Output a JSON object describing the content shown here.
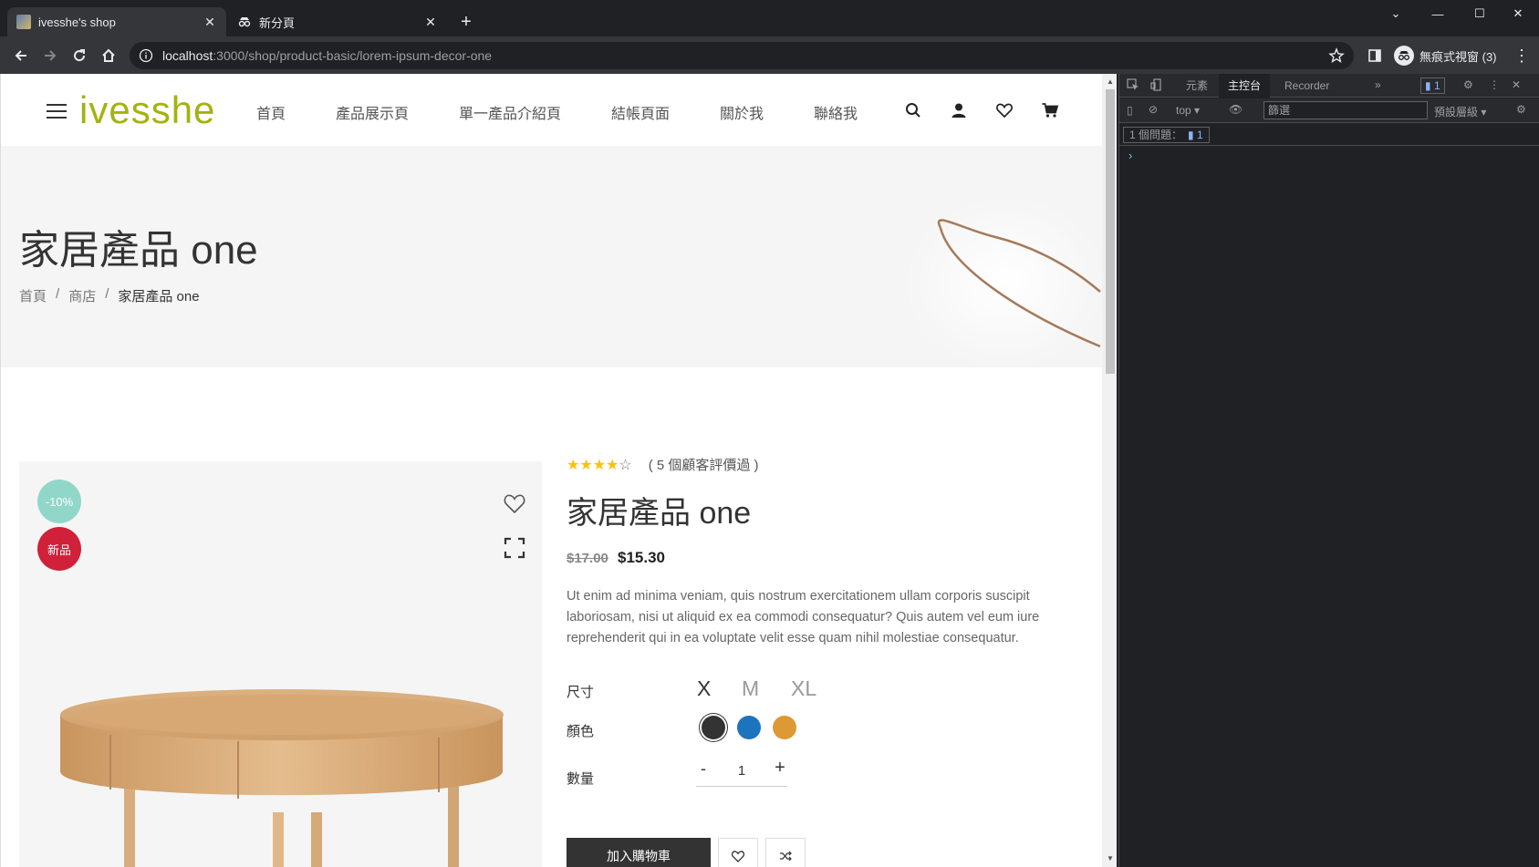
{
  "browser": {
    "tabs": [
      {
        "title": "ivesshe's shop",
        "active": true
      },
      {
        "title": "新分頁",
        "active": false
      }
    ],
    "url_host": "localhost",
    "url_path": ":3000/shop/product-basic/lorem-ipsum-decor-one",
    "profile_label": "無痕式視窗 (3)"
  },
  "site": {
    "logo": "ivesshe",
    "nav": [
      "首頁",
      "產品展示頁",
      "單一產品介紹頁",
      "結帳頁面",
      "關於我",
      "聯絡我"
    ],
    "header_icons": [
      "search-icon",
      "user-icon",
      "heart-icon",
      "cart-icon"
    ]
  },
  "banner": {
    "title": "家居產品 one",
    "breadcrumb": [
      "首頁",
      "商店",
      "家居產品 one"
    ],
    "separator": "/"
  },
  "product": {
    "badges": {
      "discount": "-10%",
      "new": "新品"
    },
    "stars": "★★★★",
    "star_empty": "☆",
    "rating_value": 4,
    "reviews": "( 5 個顧客評價過 )",
    "title": "家居產品 one",
    "price_old": "$17.00",
    "price_new": "$15.30",
    "description": "Ut enim ad minima veniam, quis nostrum exercitationem ullam corporis suscipit laboriosam, nisi ut aliquid ex ea commodi consequatur? Quis autem vel eum iure reprehenderit qui in ea voluptate velit esse quam nihil molestiae consequatur.",
    "size_label": "尺寸",
    "sizes": [
      "X",
      "M",
      "XL"
    ],
    "selected_size": "X",
    "color_label": "顏色",
    "colors": [
      "#333333",
      "#1e73be",
      "#dd9933"
    ],
    "quantity_label": "數量",
    "quantity": "1",
    "minus": "-",
    "plus": "+",
    "add_to_cart": "加入購物車"
  },
  "devtools": {
    "tabs": [
      "元素",
      "主控台",
      "Recorder"
    ],
    "active_tab": "主控台",
    "issue_badge": "1",
    "context": "top",
    "filter_placeholder": "篩選",
    "levels": "預設層級",
    "issues_text": "1 個問題：",
    "issues_count": "1",
    "prompt": "›"
  },
  "colors": {
    "brand": "#a4b30e",
    "discount_badge": "#91d7c9",
    "new_badge": "#d0203a",
    "star": "#ffc107"
  }
}
